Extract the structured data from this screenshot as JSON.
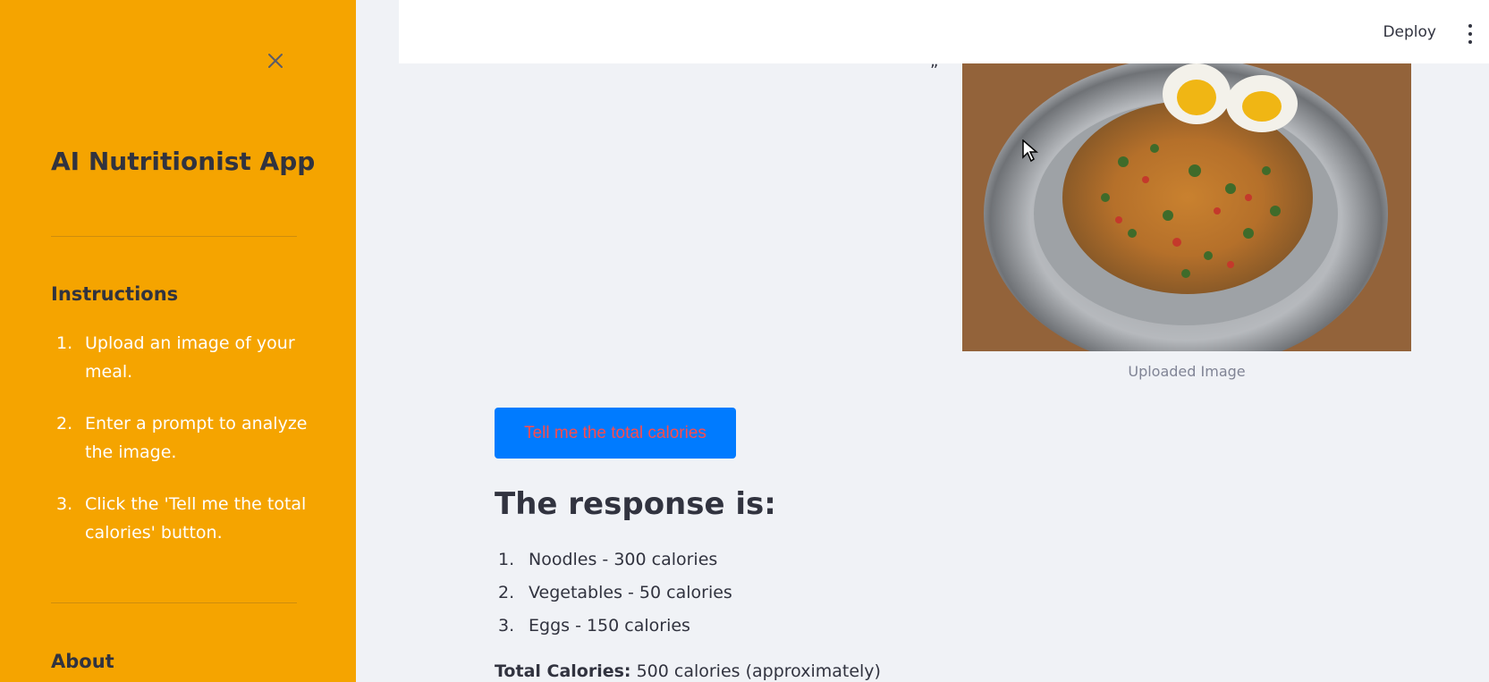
{
  "sidebar": {
    "title": "AI Nutritionist App",
    "instructions_heading": "Instructions",
    "instructions": [
      {
        "num": "1.",
        "text": "Upload an image of your meal."
      },
      {
        "num": "2.",
        "text": "Enter a prompt to analyze the image."
      },
      {
        "num": "3.",
        "text": "Click the 'Tell me the total calories' button."
      }
    ],
    "about_heading": "About"
  },
  "header": {
    "deploy_label": "Deploy"
  },
  "main": {
    "image_caption": "Uploaded Image",
    "button_label": "Tell me the total calories",
    "response_title": "The response is:",
    "response_items": [
      {
        "num": "1.",
        "text": "Noodles - 300 calories"
      },
      {
        "num": "2.",
        "text": "Vegetables - 50 calories"
      },
      {
        "num": "3.",
        "text": "Eggs - 150 calories"
      }
    ],
    "total_label": "Total Calories:",
    "total_value": " 500 calories (approximately)"
  },
  "colors": {
    "sidebar_bg": "#f5a400",
    "button_bg": "#007bff",
    "button_text": "#ff4b4b",
    "main_bg": "#f0f2f6"
  },
  "icons": [
    "close-icon",
    "kebab-menu-icon",
    "mouse-cursor-icon"
  ]
}
